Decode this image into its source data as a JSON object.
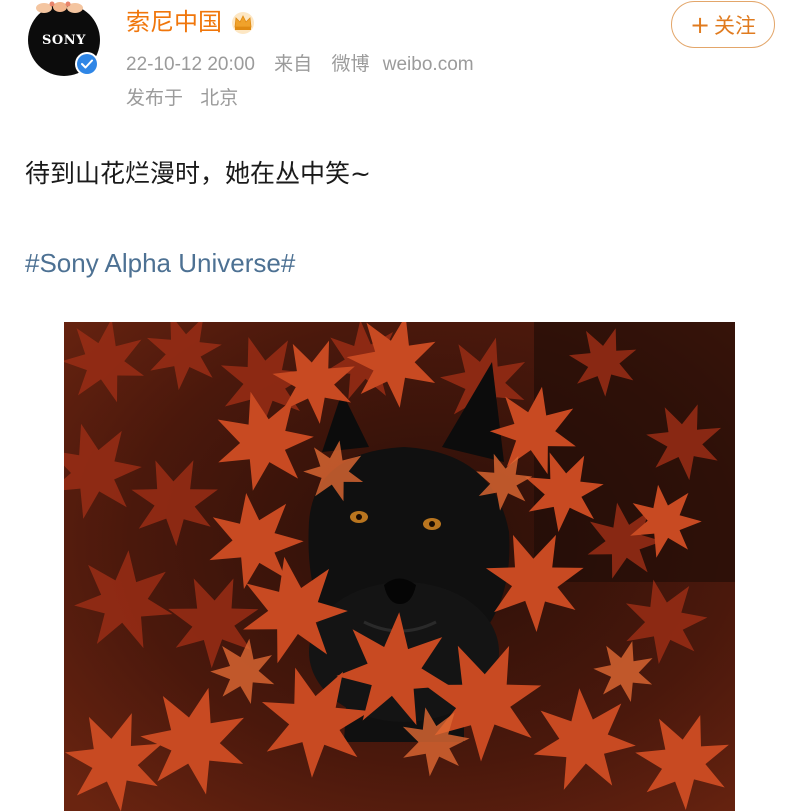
{
  "post": {
    "author": {
      "name": "索尼中国",
      "avatar_text": "SONY",
      "verified": true,
      "badge_icon": "crown-icon"
    },
    "meta": {
      "date": "22-10-12 20:00",
      "source_label": "来自",
      "source_app": "微博",
      "source_domain": "weibo.com"
    },
    "location": {
      "label": "发布于",
      "place": "北京"
    },
    "follow_button": {
      "icon": "plus-icon",
      "label": "关注"
    },
    "text": "待到山花烂漫时，她在丛中笑~",
    "hashtag": "#Sony Alpha Universe#",
    "image": {
      "subject": "black-dog-in-red-maple-leaves-photo"
    }
  },
  "colors": {
    "author_name": "#f0760b",
    "meta_text": "#9b9b9b",
    "hashtag": "#4d7193",
    "follow_border": "#e3a66a",
    "follow_text": "#e07b1f",
    "verified_badge": "#2f86e6"
  }
}
